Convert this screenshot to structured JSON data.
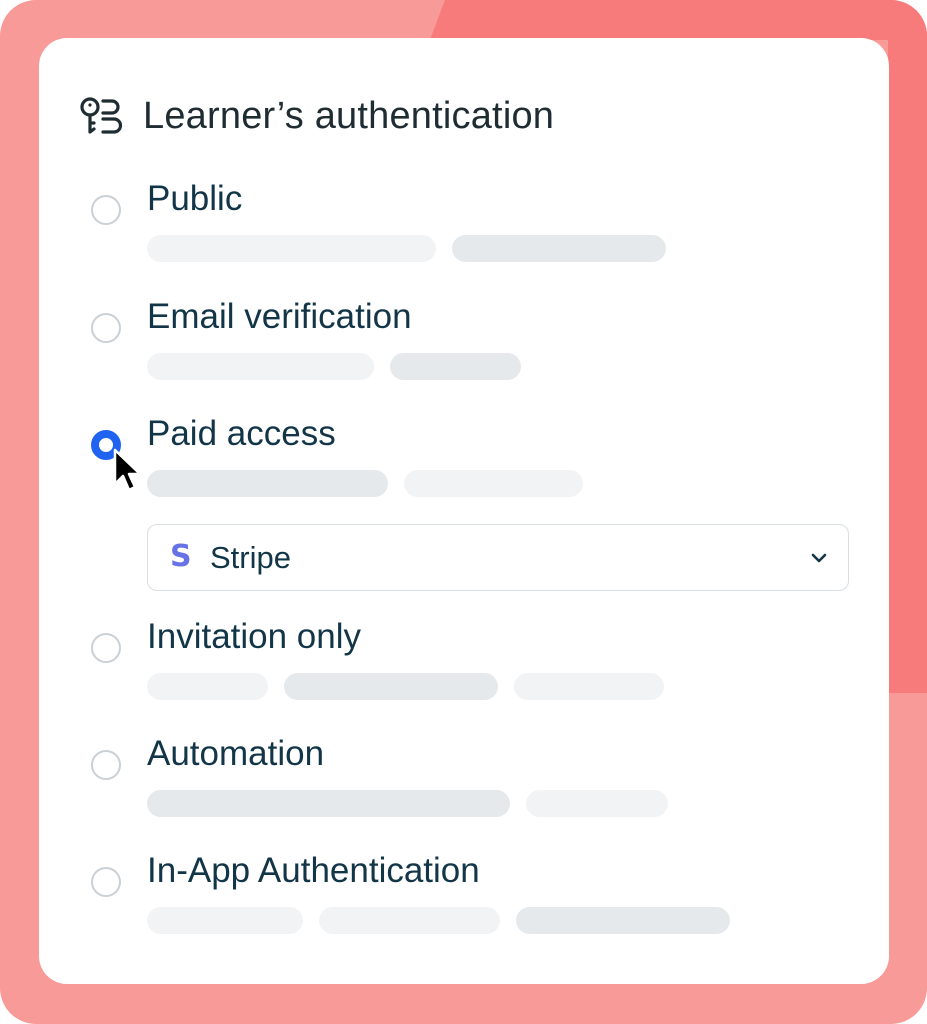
{
  "panel": {
    "title": "Learner’s authentication",
    "title_icon": "key-list-icon"
  },
  "options": [
    {
      "label": "Public",
      "selected": false
    },
    {
      "label": "Email verification",
      "selected": false
    },
    {
      "label": "Paid access",
      "selected": true
    },
    {
      "label": "Invitation only",
      "selected": false
    },
    {
      "label": "Automation",
      "selected": false
    },
    {
      "label": "In-App Authentication",
      "selected": false
    }
  ],
  "payment_provider": {
    "value": "Stripe",
    "icon": "stripe-s-icon",
    "dropdown_icon": "chevron-down-icon"
  },
  "colors": {
    "accent": "#1f63f0",
    "text": "#123548",
    "stripe": "#6772e5",
    "background": "#f79a98",
    "background_dark": "#f87c7c"
  },
  "cursor": "arrow-pointer-icon"
}
